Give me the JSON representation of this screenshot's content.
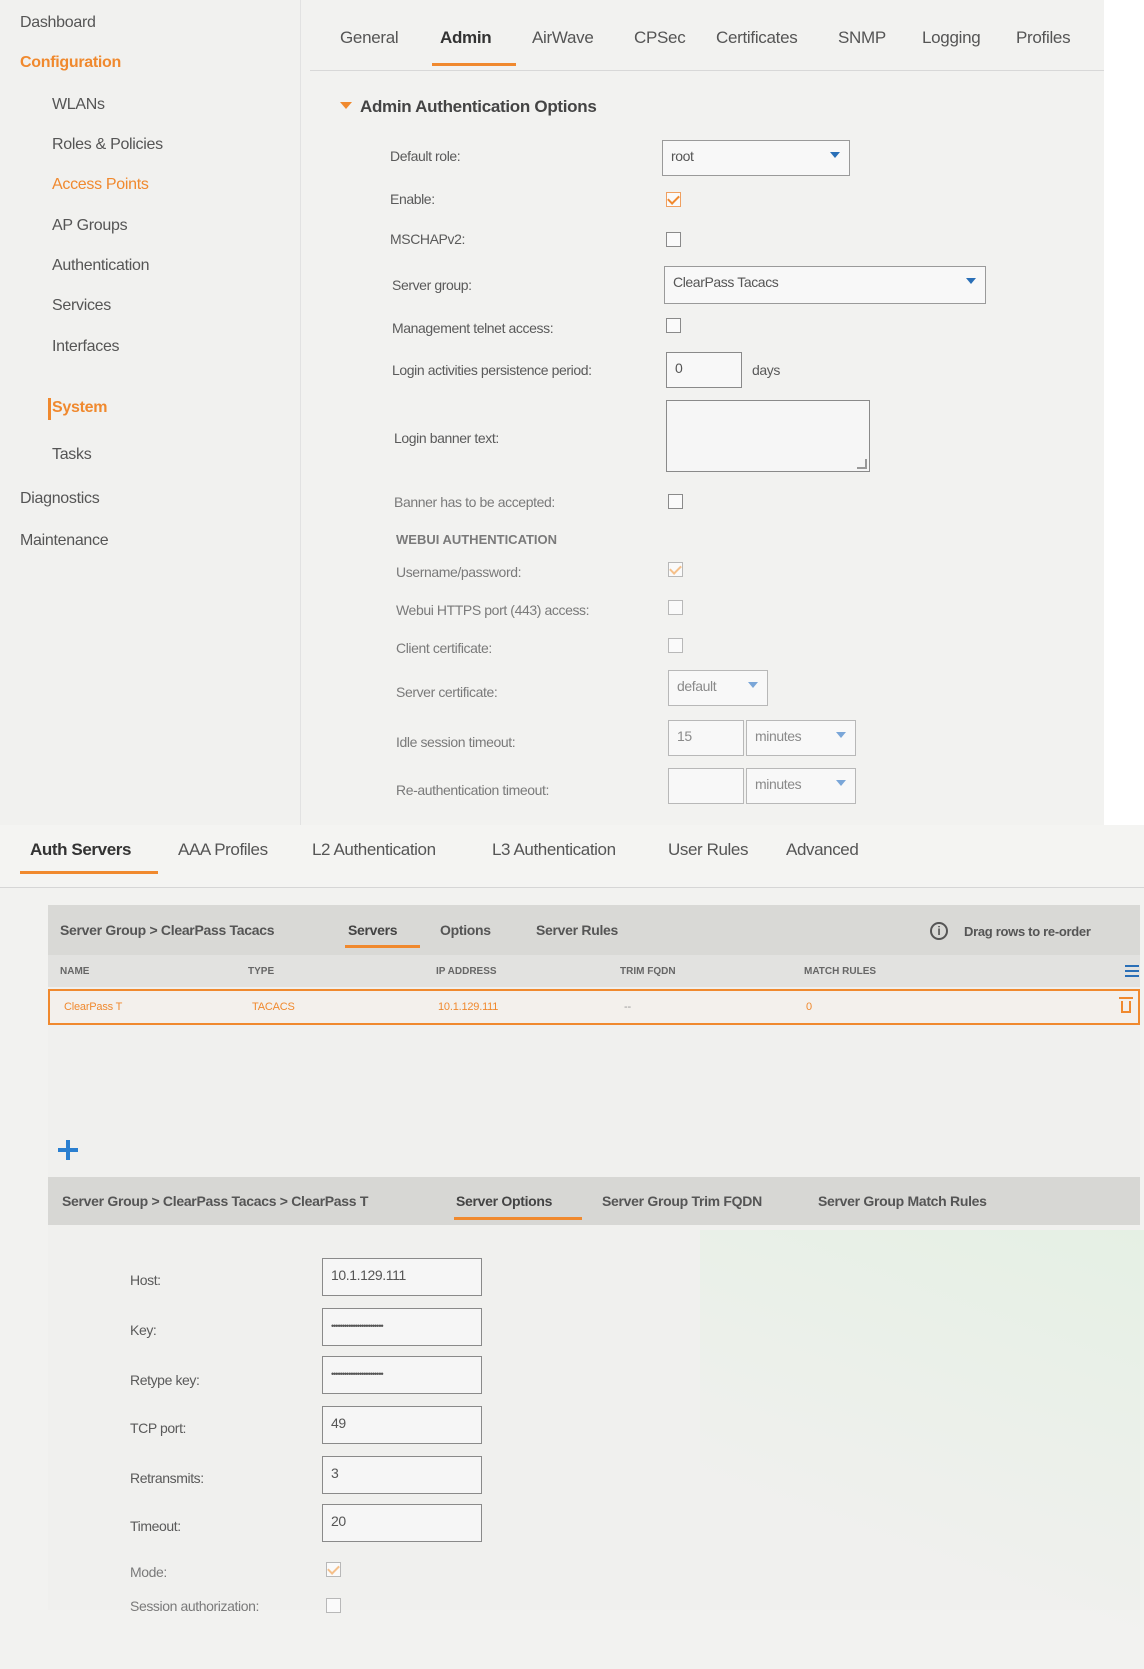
{
  "sidebar": {
    "items": [
      {
        "label": "Dashboard"
      },
      {
        "label": "Configuration"
      },
      {
        "label": "WLANs"
      },
      {
        "label": "Roles & Policies"
      },
      {
        "label": "Access Points"
      },
      {
        "label": "AP Groups"
      },
      {
        "label": "Authentication"
      },
      {
        "label": "Services"
      },
      {
        "label": "Interfaces"
      },
      {
        "label": "System"
      },
      {
        "label": "Tasks"
      },
      {
        "label": "Diagnostics"
      },
      {
        "label": "Maintenance"
      }
    ]
  },
  "system_tabs": [
    "General",
    "Admin",
    "AirWave",
    "CPSec",
    "Certificates",
    "SNMP",
    "Logging",
    "Profiles"
  ],
  "admin_auth": {
    "title": "Admin Authentication Options",
    "default_role_label": "Default role:",
    "default_role_value": "root",
    "enable_label": "Enable:",
    "enable_checked": true,
    "mschapv2_label": "MSCHAPv2:",
    "mschapv2_checked": false,
    "server_group_label": "Server group:",
    "server_group_value": "ClearPass Tacacs",
    "telnet_label": "Management telnet access:",
    "telnet_checked": false,
    "persistence_label": "Login activities persistence period:",
    "persistence_value": "0",
    "persistence_unit": "days",
    "banner_text_label": "Login banner text:",
    "banner_accept_label": "Banner has to be accepted:",
    "banner_accept_checked": false,
    "webui_heading": "WEBUI AUTHENTICATION",
    "userpass_label": "Username/password:",
    "userpass_checked": true,
    "https_label": "Webui HTTPS port (443) access:",
    "https_checked": false,
    "client_cert_label": "Client certificate:",
    "client_cert_checked": false,
    "server_cert_label": "Server certificate:",
    "server_cert_value": "default",
    "idle_label": "Idle session timeout:",
    "idle_value": "15",
    "idle_unit": "minutes",
    "reauth_label": "Re-authentication timeout:",
    "reauth_value": "",
    "reauth_unit": "minutes"
  },
  "auth_tabs": [
    "Auth Servers",
    "AAA Profiles",
    "L2 Authentication",
    "L3 Authentication",
    "User Rules",
    "Advanced"
  ],
  "server_group": {
    "breadcrumb": "Server Group > ClearPass Tacacs",
    "tabs": [
      "Servers",
      "Options",
      "Server Rules"
    ],
    "drag_hint": "Drag rows to re-order",
    "columns": [
      "NAME",
      "TYPE",
      "IP ADDRESS",
      "TRIM FQDN",
      "MATCH RULES"
    ],
    "rows": [
      {
        "name": "ClearPass T",
        "type": "TACACS",
        "ip": "10.1.129.111",
        "trim": "--",
        "match": "0"
      }
    ]
  },
  "server_options": {
    "breadcrumb": "Server Group > ClearPass Tacacs > ClearPass T",
    "tabs": [
      "Server Options",
      "Server Group Trim FQDN",
      "Server Group Match Rules"
    ],
    "host_label": "Host:",
    "host_value": "10.1.129.111",
    "key_label": "Key:",
    "key_value": "••••••••••••••••••••••••",
    "retype_label": "Retype key:",
    "retype_value": "••••••••••••••••••••••••",
    "tcp_label": "TCP port:",
    "tcp_value": "49",
    "retrans_label": "Retransmits:",
    "retrans_value": "3",
    "timeout_label": "Timeout:",
    "timeout_value": "20",
    "mode_label": "Mode:",
    "mode_checked": true,
    "session_label": "Session authorization:",
    "session_checked": false
  },
  "colors": {
    "accent": "#f0892e",
    "link_blue": "#2a6fb7",
    "header_gray": "#d9d9d6"
  }
}
